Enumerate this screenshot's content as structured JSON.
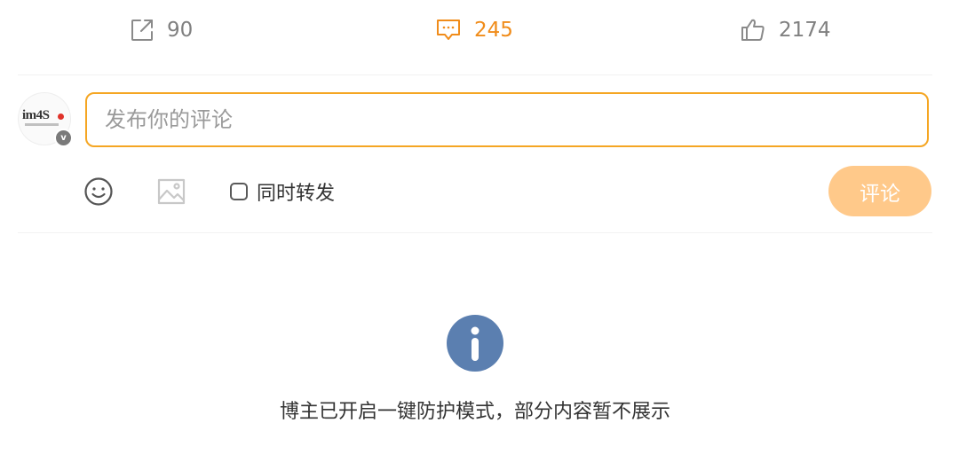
{
  "actions": {
    "forward": {
      "count": "90",
      "icon": "share-icon"
    },
    "comment": {
      "count": "245",
      "icon": "comment-icon",
      "active_color": "#f08c1a"
    },
    "like": {
      "count": "2174",
      "icon": "thumbs-up-icon"
    }
  },
  "avatar": {
    "logo_text": "im4S",
    "verified_mark": "v"
  },
  "composer": {
    "placeholder": "发布你的评论",
    "value": "",
    "emoji_icon": "smiley-icon",
    "image_icon": "image-icon",
    "also_forward_label": "同时转发",
    "also_forward_checked": false,
    "submit_label": "评论",
    "accent_color": "#f5a623"
  },
  "notice": {
    "icon": "info-icon",
    "text": "博主已开启一键防护模式，部分内容暂不展示",
    "icon_color": "#5b7fb0"
  }
}
